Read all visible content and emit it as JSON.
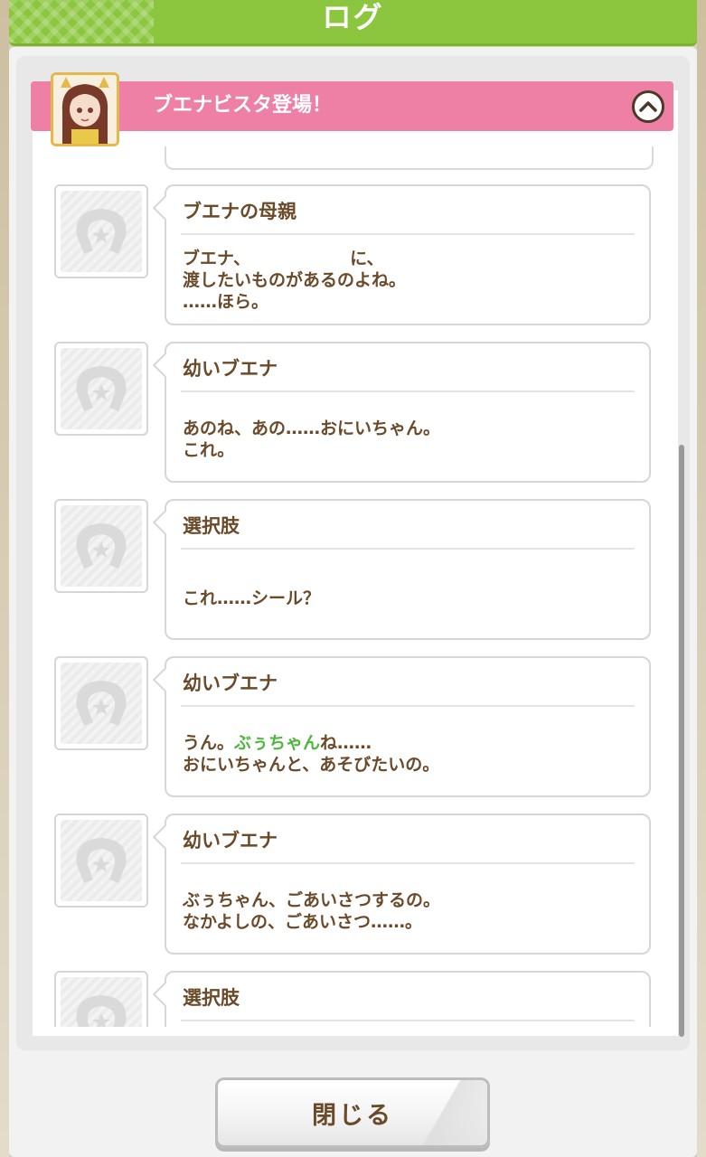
{
  "header": {
    "title": "ログ"
  },
  "chapter": {
    "title": "ブエナビスタ登場！"
  },
  "entries": [
    {
      "speaker": "ブエナの母親",
      "text": "ブエナ、",
      "text_after": "に、\n渡したいものがあるのよね。\n……ほら。"
    },
    {
      "speaker": "幼いブエナ",
      "text": "あのね、あの……おにいちゃん。\nこれ。"
    },
    {
      "speaker": "選択肢",
      "text": "これ……シール？"
    },
    {
      "speaker": "幼いブエナ",
      "text_pre": "うん。",
      "highlight": "ぶぅちゃん",
      "text_post": "ね……\nおにいちゃんと、あそびたいの。"
    },
    {
      "speaker": "幼いブエナ",
      "text": "ぶぅちゃん、ごあいさつするの。\nなかよしの、ごあいさつ……。"
    },
    {
      "speaker": "選択肢",
      "text": ""
    }
  ],
  "footer": {
    "close_label": "閉じる"
  },
  "colors": {
    "header": "#8cc63f",
    "chapter": "#ee7fa5",
    "text": "#6b4a2a",
    "highlight": "#4cb83c"
  }
}
